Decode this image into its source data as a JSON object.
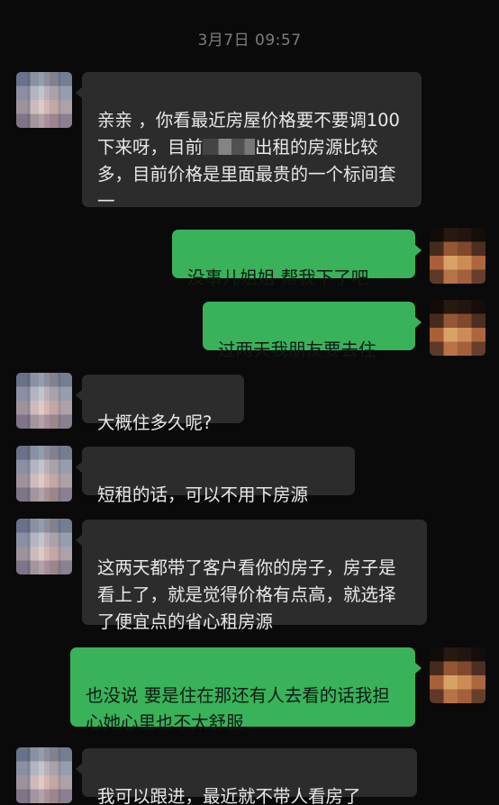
{
  "timestamp": "3月7日 09:57",
  "messages": [
    {
      "sender": "partner",
      "text_before": "亲亲 ，你看最近房屋价格要不要调100下来呀，目前",
      "text_after": "出租的房源比较多，目前价格是里面最贵的一个标间套一"
    },
    {
      "sender": "self",
      "text": "没事儿姐姐 帮我下了吧"
    },
    {
      "sender": "self",
      "text": "过两天我朋友要去住"
    },
    {
      "sender": "partner",
      "text": "大概住多久呢?"
    },
    {
      "sender": "partner",
      "text": "短租的话，可以不用下房源"
    },
    {
      "sender": "partner",
      "text": "这两天都带了客户看你的房子，房子是看上了，就是觉得价格有点高，就选择了便宜点的省心租房源"
    },
    {
      "sender": "self",
      "text": "也没说 要是住在那还有人去看的话我担心她心里也不太舒服"
    },
    {
      "sender": "partner",
      "text": "我可以跟进，最近就不带人看房了"
    }
  ],
  "colors": {
    "background": "#0a0a0a",
    "incoming_bubble": "#2c2c2c",
    "outgoing_bubble": "#39b25a"
  }
}
